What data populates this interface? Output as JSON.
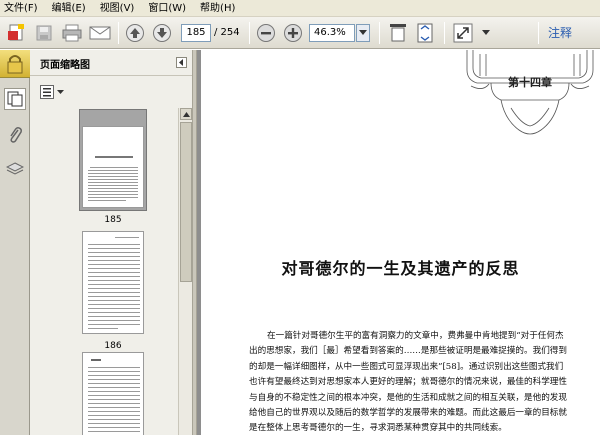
{
  "menu": {
    "items": [
      "文件(F)",
      "编辑(E)",
      "视图(V)",
      "窗口(W)",
      "帮助(H)"
    ]
  },
  "toolbar": {
    "current_page": "185",
    "total_pages": "/ 254",
    "zoom": "46.3%",
    "annotate_label": "注释",
    "icons": [
      "create-pdf-icon",
      "save-icon",
      "print-icon",
      "email-icon",
      "previous-page-icon",
      "next-page-icon",
      "zoom-out-icon",
      "zoom-in-icon",
      "single-page-icon",
      "fit-page-icon",
      "fullscreen-icon"
    ]
  },
  "panel": {
    "title": "页面缩略图",
    "thumbnails": [
      {
        "page": "185",
        "selected": true
      },
      {
        "page": "186",
        "selected": false
      },
      {
        "page": "",
        "selected": false
      }
    ]
  },
  "document": {
    "chapter": "第十四章",
    "title": "对哥德尔的一生及其遗产的反思",
    "paragraphs": [
      "在一篇针对哥德尔生平的富有洞察力的文章中，费弗曼中肯地提到“对于任何杰",
      "出的思想家，我们［最］希望看到答案的……是那些被证明是最难捉摸的。我们得到",
      "的却是一幅详细图样，从中一些图式可显浮现出来”[58]。通过识别出这些图式我们",
      "也许有望最终达到对思想家本人更好的理解；就哥德尔的情况来说，最佳的科学理性",
      "与自身的不稳定性之间的根本冲突，是他的生活和成就之间的相互关联，是他的发现",
      "给他自己的世界观以及随后的数学哲学的发展带来的难题。而此这最后一章的目标就",
      "是在整体上思考哥德尔的一生，寻求洞悉某种贯穿其中的共同线索。"
    ]
  },
  "colors": {
    "chrome": "#ece9d8",
    "doc_background": "#8e8e8e",
    "accent": "#2a5db0"
  }
}
